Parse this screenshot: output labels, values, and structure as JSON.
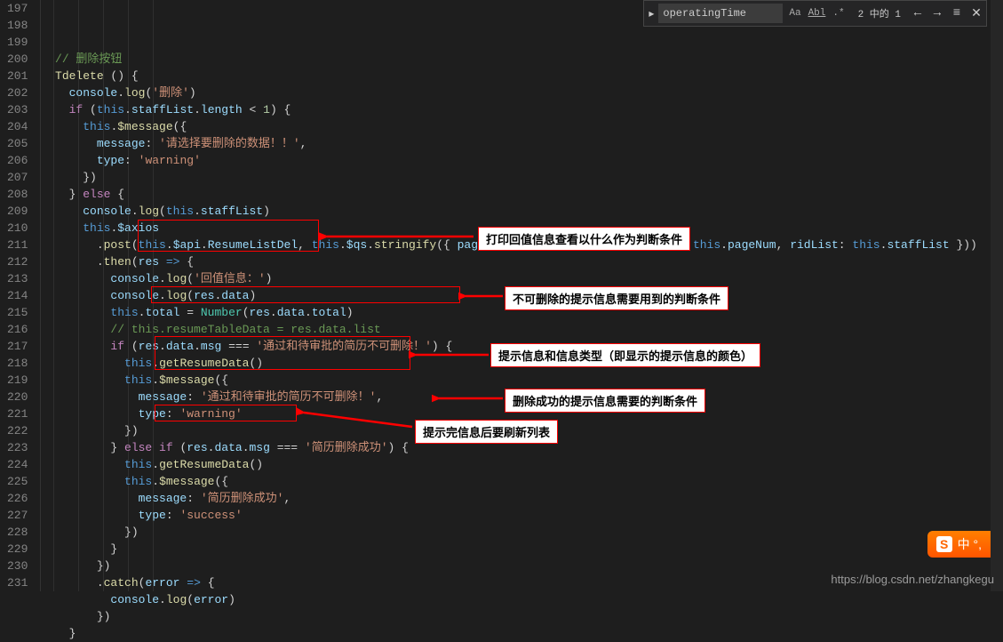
{
  "search": {
    "value": "operatingTime",
    "count": "2 中的 1"
  },
  "lineStart": 197,
  "lineEnd": 231,
  "code": {
    "l197": "// 删除按钮",
    "l198_func": "Tdelete",
    "l199_log": "console",
    "l199_str": "'删除'",
    "l200_cond": "this.staffList.length < 1",
    "l202_msg": "'请选择要删除的数据！！'",
    "l203_type": "'warning'",
    "l206_arg": "this.staffList",
    "l208_api": "this.$api.ResumeListDel",
    "l208_params": "pageSize: this.pageSize, pageNum: this.pageNum, ridList: this.staffList",
    "l210_str": "'回值信息：'",
    "l211_arg": "res.data",
    "l212_num": "Number(res.data.total)",
    "l213_comment": "// this.resumeTableData = res.data.list",
    "l214_cond": "res.data.msg === '通过和待审批的简历不可删除！'",
    "l217_msg": "'通过和待审批的简历不可删除！'",
    "l218_type": "'warning'",
    "l220_cond": "res.data.msg === '简历删除成功'",
    "l223_msg": "'简历删除成功'",
    "l224_type": "'success'",
    "l229_arg": "error"
  },
  "annotations": {
    "a1": "打印回值信息查看以什么作为判断条件",
    "a2": "不可删除的提示信息需要用到的判断条件",
    "a3": "提示信息和信息类型（即显示的提示信息的颜色）",
    "a4": "删除成功的提示信息需要的判断条件",
    "a5": "提示完信息后要刷新列表"
  },
  "sogou": "中 °,",
  "watermark": "https://blog.csdn.net/zhangkegu"
}
